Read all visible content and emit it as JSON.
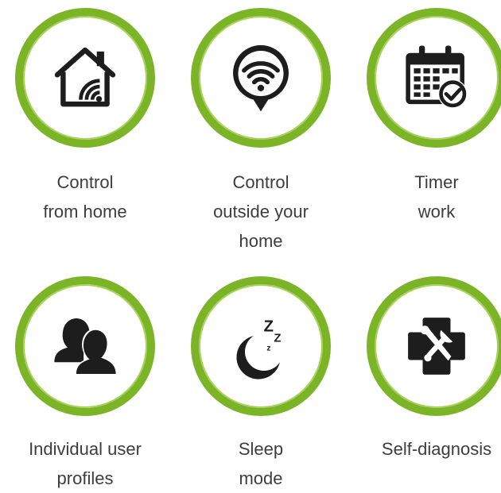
{
  "features": [
    {
      "icon": "smart-home-wifi-icon",
      "lines": [
        "Control",
        "from home"
      ]
    },
    {
      "icon": "location-wifi-icon",
      "lines": [
        "Control",
        "outside your",
        "home"
      ]
    },
    {
      "icon": "calendar-check-icon",
      "lines": [
        "Timer",
        "work"
      ]
    },
    {
      "icon": "users-icon",
      "lines": [
        "Individual user",
        "profiles"
      ]
    },
    {
      "icon": "moon-sleep-icon",
      "lines": [
        "Sleep",
        "mode"
      ]
    },
    {
      "icon": "repair-tools-icon",
      "lines": [
        "Self-diagnosis"
      ]
    }
  ],
  "colors": {
    "ring": "#7cb427",
    "icon": "#1d1d1d",
    "text": "#3d3d3d"
  }
}
